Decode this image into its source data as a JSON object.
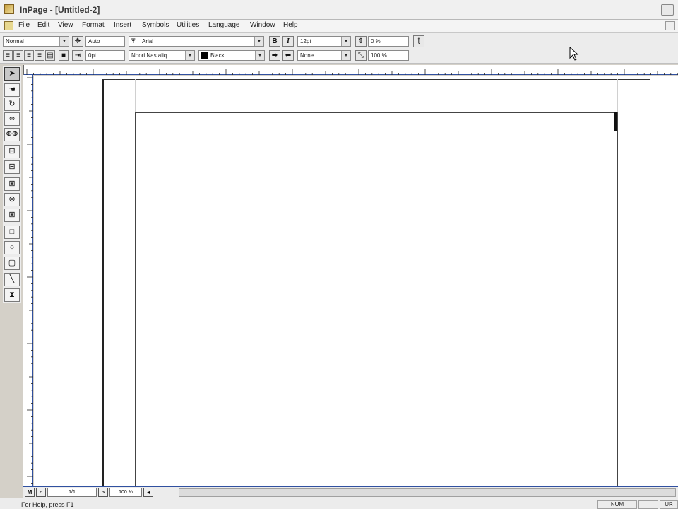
{
  "window": {
    "title": "InPage - [Untitled-2]"
  },
  "menu": [
    "File",
    "Edit",
    "View",
    "Format",
    "Insert",
    "Symbols",
    "Utilities",
    "Language",
    "Window",
    "Help"
  ],
  "toolbar": {
    "style": "Normal",
    "leading": "Auto",
    "english_font": "Arial",
    "bold_label": "B",
    "italic_label": "I",
    "font_size": "12pt",
    "tracking": "0 %",
    "indent": "0pt",
    "urdu_font": "Noori Nastaliq",
    "color": "Black",
    "underline_style": "None",
    "scale": "100 %"
  },
  "nav": {
    "master_label": "M",
    "prev_label": "<",
    "page": "1/1",
    "next_label": ">",
    "zoom": "100 %"
  },
  "status": {
    "help": "For Help, press F1",
    "num": "NUM",
    "lang": "UR"
  },
  "colors": {
    "ruler_accent": "#3050a0",
    "chrome": "#ececec"
  }
}
